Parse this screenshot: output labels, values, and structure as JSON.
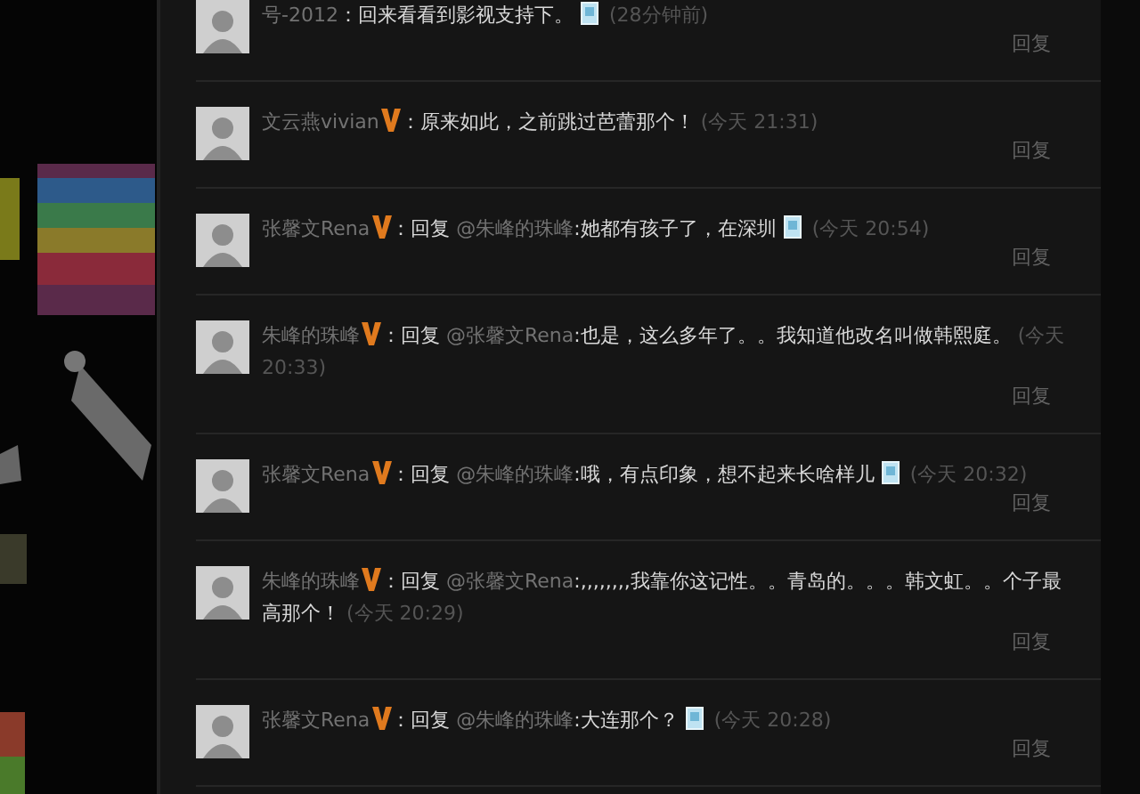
{
  "comments": [
    {
      "author": "号-2012",
      "verified": false,
      "separator": "：",
      "text": "回来看看到影视支持下。",
      "has_emoticon": true,
      "time": "(28分钟前)",
      "reply_label": "回复"
    },
    {
      "author": "文云燕vivian",
      "verified": true,
      "separator": "：",
      "text": "原来如此，之前跳过芭蕾那个！",
      "has_emoticon": false,
      "time": "(今天 21:31)",
      "reply_label": "回复"
    },
    {
      "author": "张馨文Rena",
      "verified": true,
      "separator": "：",
      "reply_prefix": "回复",
      "mention": "@朱峰的珠峰",
      "text": ":她都有孩子了，在深圳",
      "has_emoticon": true,
      "time": "(今天 20:54)",
      "reply_label": "回复"
    },
    {
      "author": "朱峰的珠峰",
      "verified": true,
      "separator": "：",
      "reply_prefix": "回复",
      "mention": "@张馨文Rena",
      "text": ":也是，这么多年了。。我知道他改名叫做韩熙庭。",
      "has_emoticon": false,
      "time": "(今天 20:33)",
      "reply_label": "回复"
    },
    {
      "author": "张馨文Rena",
      "verified": true,
      "separator": "：",
      "reply_prefix": "回复",
      "mention": "@朱峰的珠峰",
      "text": ":哦，有点印象，想不起来长啥样儿",
      "has_emoticon": true,
      "time": "(今天 20:32)",
      "reply_label": "回复"
    },
    {
      "author": "朱峰的珠峰",
      "verified": true,
      "separator": "：",
      "reply_prefix": "回复",
      "mention": "@张馨文Rena",
      "text": ":,,,,,,,,我靠你这记性。。青岛的。。。韩文虹。。个子最高那个！",
      "has_emoticon": false,
      "time": "(今天 20:29)",
      "reply_label": "回复"
    },
    {
      "author": "张馨文Rena",
      "verified": true,
      "separator": "：",
      "reply_prefix": "回复",
      "mention": "@朱峰的珠峰",
      "text": ":大连那个？",
      "has_emoticon": true,
      "time": "(今天 20:28)",
      "reply_label": "回复"
    }
  ]
}
